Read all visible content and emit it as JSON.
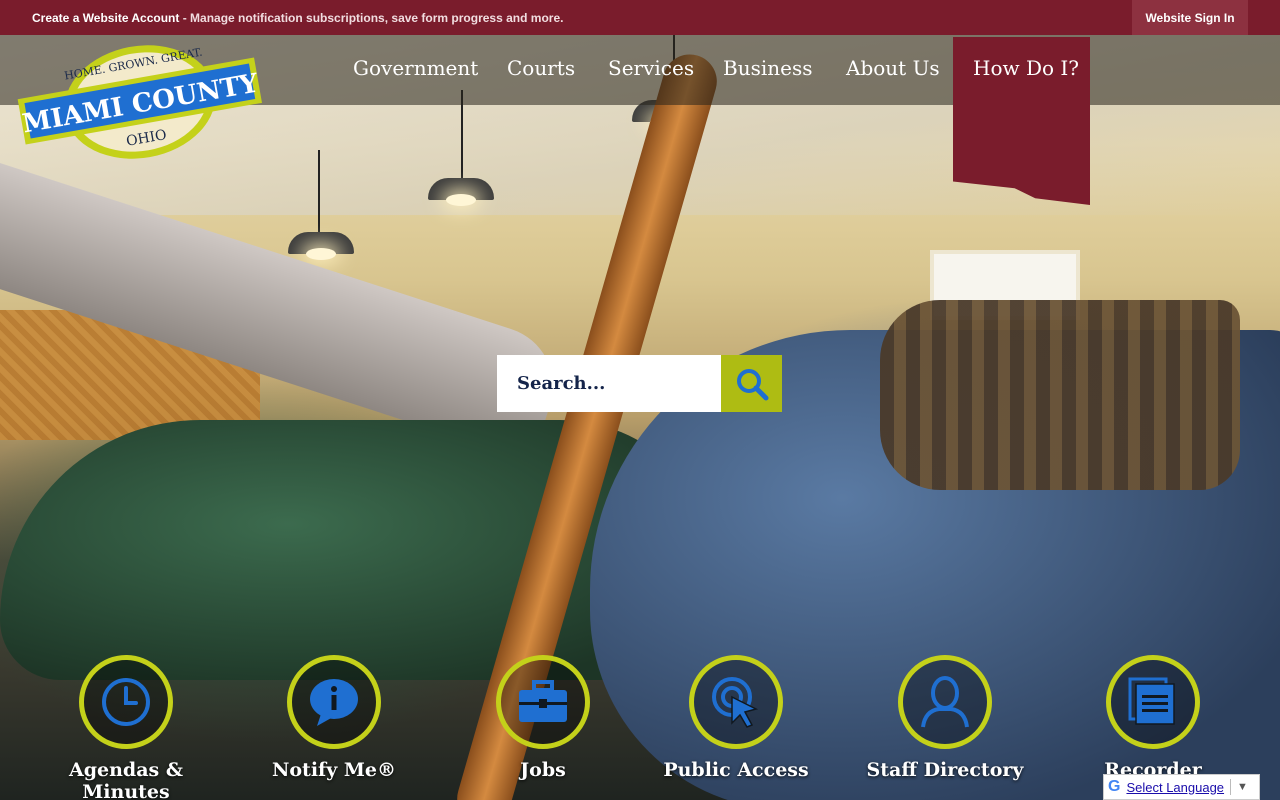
{
  "topbar": {
    "lead": "Create a Website Account",
    "rest": " - Manage notification subscriptions, save form progress and more.",
    "signin": "Website Sign In"
  },
  "logo": {
    "top_text": "HOME. GROWN. GREAT.",
    "name": "MIAMI COUNTY",
    "state": "OHIO"
  },
  "nav": {
    "items": [
      "Government",
      "Courts",
      "Services",
      "Business",
      "About Us"
    ],
    "howdoi": "How Do I?"
  },
  "search": {
    "placeholder": "Search..."
  },
  "quick_links": [
    {
      "label": "Agendas & Minutes",
      "icon": "clock-icon"
    },
    {
      "label": "Notify Me®",
      "icon": "info-bubble-icon"
    },
    {
      "label": "Jobs",
      "icon": "briefcase-icon"
    },
    {
      "label": "Public Access",
      "icon": "cursor-click-icon"
    },
    {
      "label": "Staff Directory",
      "icon": "person-icon"
    },
    {
      "label": "Recorder",
      "icon": "documents-icon"
    }
  ],
  "translate": {
    "label": "Select Language",
    "icon": "google-g-icon"
  },
  "colors": {
    "maroon": "#7a1c2c",
    "accent_green": "#c4d11a",
    "search_button": "#aebc13",
    "icon_blue": "#1f6fd1"
  }
}
